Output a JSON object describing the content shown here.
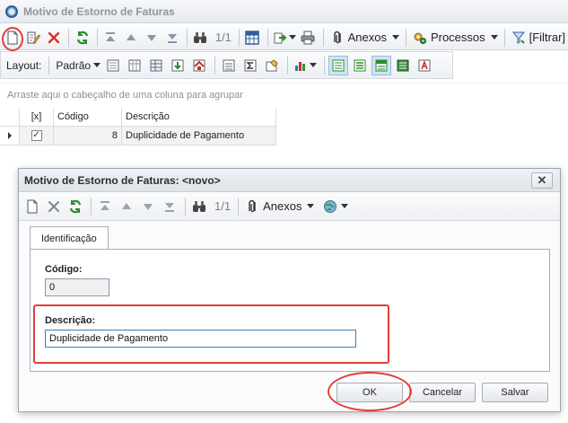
{
  "window": {
    "title": "Motivo de Estorno de Faturas"
  },
  "toolbar": {
    "counter": "1/1",
    "anexos_label": "Anexos",
    "processos_label": "Processos",
    "filtrar_label": "[Filtrar]"
  },
  "layout_bar": {
    "layout_label": "Layout:",
    "padrao_label": "Padrão"
  },
  "group_area": {
    "hint": "Arraste aqui o cabeçalho de uma coluna para agrupar"
  },
  "grid": {
    "columns": [
      "[x]",
      "Código",
      "Descrição"
    ],
    "rows": [
      {
        "checked": true,
        "codigo": "8",
        "descricao": "Duplicidade de Pagamento"
      }
    ]
  },
  "dialog": {
    "title": "Motivo de Estorno de Faturas: <novo>",
    "counter": "1/1",
    "anexos_label": "Anexos",
    "tab_label": "Identificação",
    "codigo_label": "Código:",
    "codigo_value": "0",
    "descricao_label": "Descrição:",
    "descricao_value": "Duplicidade de Pagamento",
    "ok_label": "OK",
    "cancel_label": "Cancelar",
    "save_label": "Salvar"
  },
  "colors": {
    "highlight_red": "#e0403a",
    "accent_blue": "#2f5f9b"
  }
}
